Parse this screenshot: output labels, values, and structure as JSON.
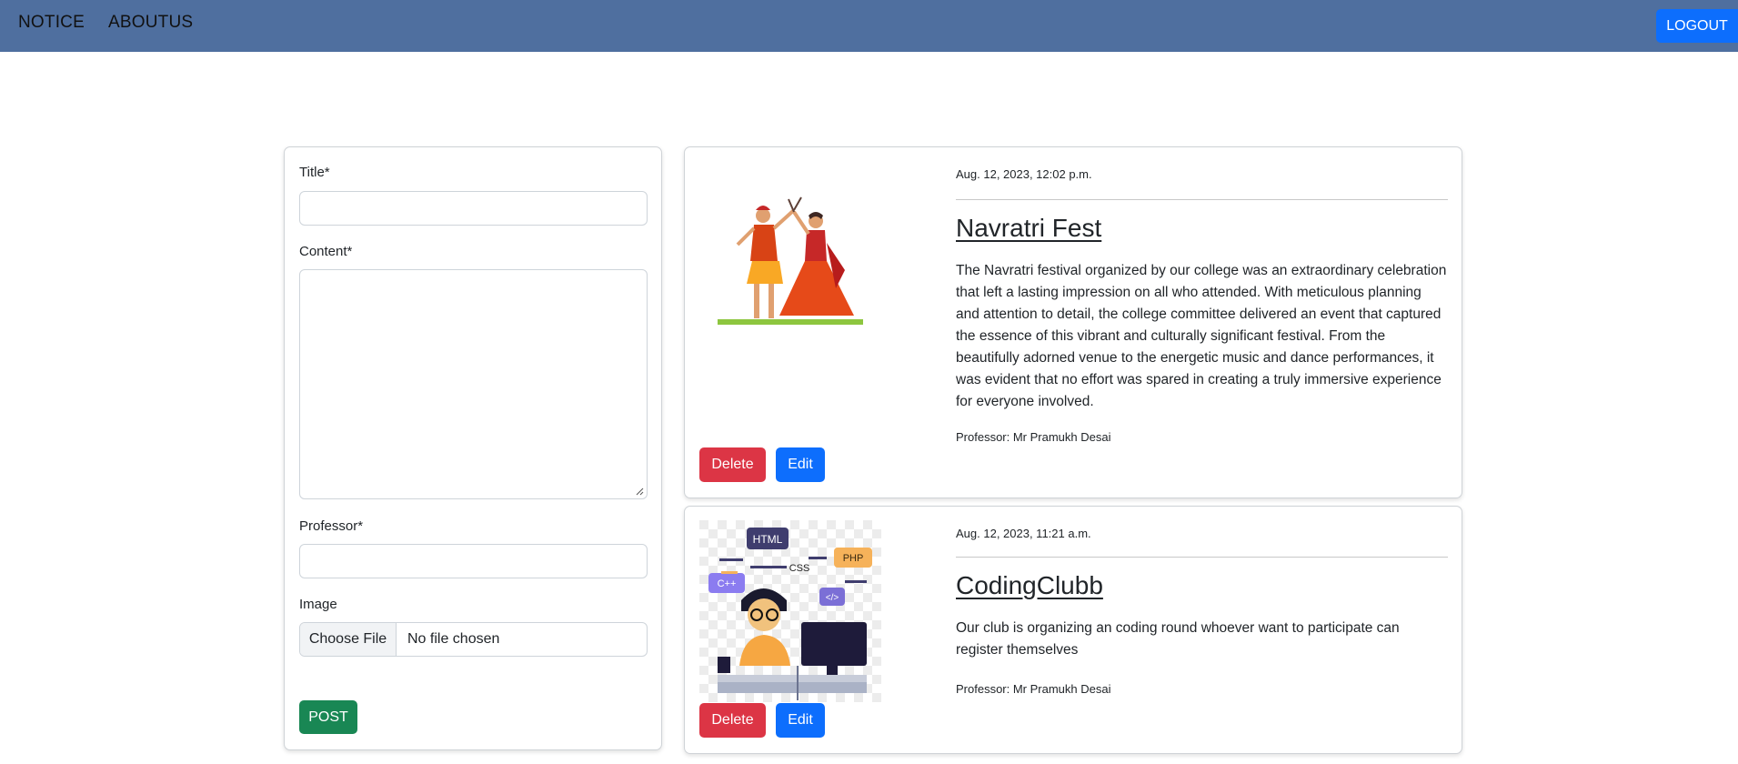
{
  "nav": {
    "links": [
      "NOTICE",
      "ABOUTUS"
    ],
    "logout_label": "LOGOUT"
  },
  "form": {
    "title_label": "Title*",
    "content_label": "Content*",
    "professor_label": "Professor*",
    "image_label": "Image",
    "file_button_label": "Choose File",
    "file_status": "No file chosen",
    "post_label": "POST"
  },
  "notices": [
    {
      "date": "Aug. 12, 2023, 12:02 p.m.",
      "title": "Navratri Fest",
      "content": "The Navratri festival organized by our college was an extraordinary celebration that left a lasting impression on all who attended. With meticulous planning and attention to detail, the college committee delivered an event that captured the essence of this vibrant and culturally significant festival. From the beautifully adorned venue to the energetic music and dance performances, it was evident that no effort was spared in creating a truly immersive experience for everyone involved.",
      "professor": "Professor: Mr Pramukh Desai",
      "delete_label": "Delete",
      "edit_label": "Edit",
      "image_icon": "garba-dancers-illustration"
    },
    {
      "date": "Aug. 12, 2023, 11:21 a.m.",
      "title": "CodingClubb",
      "content": "Our club is organizing an coding round whoever want to participate can register themselves",
      "professor": "Professor: Mr Pramukh Desai",
      "delete_label": "Delete",
      "edit_label": "Edit",
      "image_icon": "coder-illustration",
      "image_tags": [
        "HTML",
        "CSS",
        "PHP",
        "C++",
        "</>"
      ]
    }
  ],
  "colors": {
    "navbar": "#4f6f9f",
    "primary": "#0d6efd",
    "danger": "#dc3545",
    "success": "#198754"
  }
}
